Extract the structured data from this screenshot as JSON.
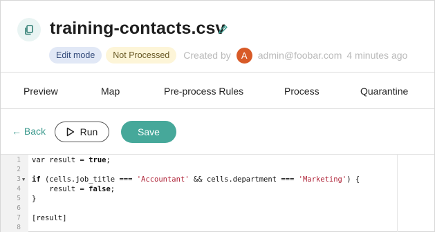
{
  "header": {
    "title": "training-contacts.csv",
    "mode_badge": "Edit mode",
    "status_badge": "Not Processed",
    "created_label": "Created by",
    "avatar_letter": "A",
    "creator": "admin@foobar.com",
    "created_ago": "4 minutes ago"
  },
  "tabs": [
    {
      "label": "Preview"
    },
    {
      "label": "Map"
    },
    {
      "label": "Pre-process Rules"
    },
    {
      "label": "Process"
    },
    {
      "label": "Quarantine"
    }
  ],
  "toolbar": {
    "back_label": "← Back",
    "run_label": "Run",
    "save_label": "Save"
  },
  "editor": {
    "line_numbers": [
      "1",
      "2",
      "3",
      "4",
      "5",
      "6",
      "7",
      "8"
    ],
    "lines": [
      {
        "pre": "var result = ",
        "kw": "true",
        "post": ";"
      },
      {
        "pre": "",
        "kw": "",
        "post": ""
      },
      {
        "kw1": "if",
        "p1": " (cells.job_title === ",
        "s1": "'Accountant'",
        "p2": " && cells.department === ",
        "s2": "'Marketing'",
        "p3": ") {"
      },
      {
        "pre": "    result = ",
        "kw": "false",
        "post": ";"
      },
      {
        "pre": "}",
        "kw": "",
        "post": ""
      },
      {
        "pre": "",
        "kw": "",
        "post": ""
      },
      {
        "pre": "[result]",
        "kw": "",
        "post": ""
      },
      {
        "pre": "",
        "kw": "",
        "post": ""
      }
    ]
  },
  "colors": {
    "accent": "#46a89a",
    "link": "#3c9a8e",
    "avatar": "#d85a27",
    "string": "#b0263a"
  }
}
